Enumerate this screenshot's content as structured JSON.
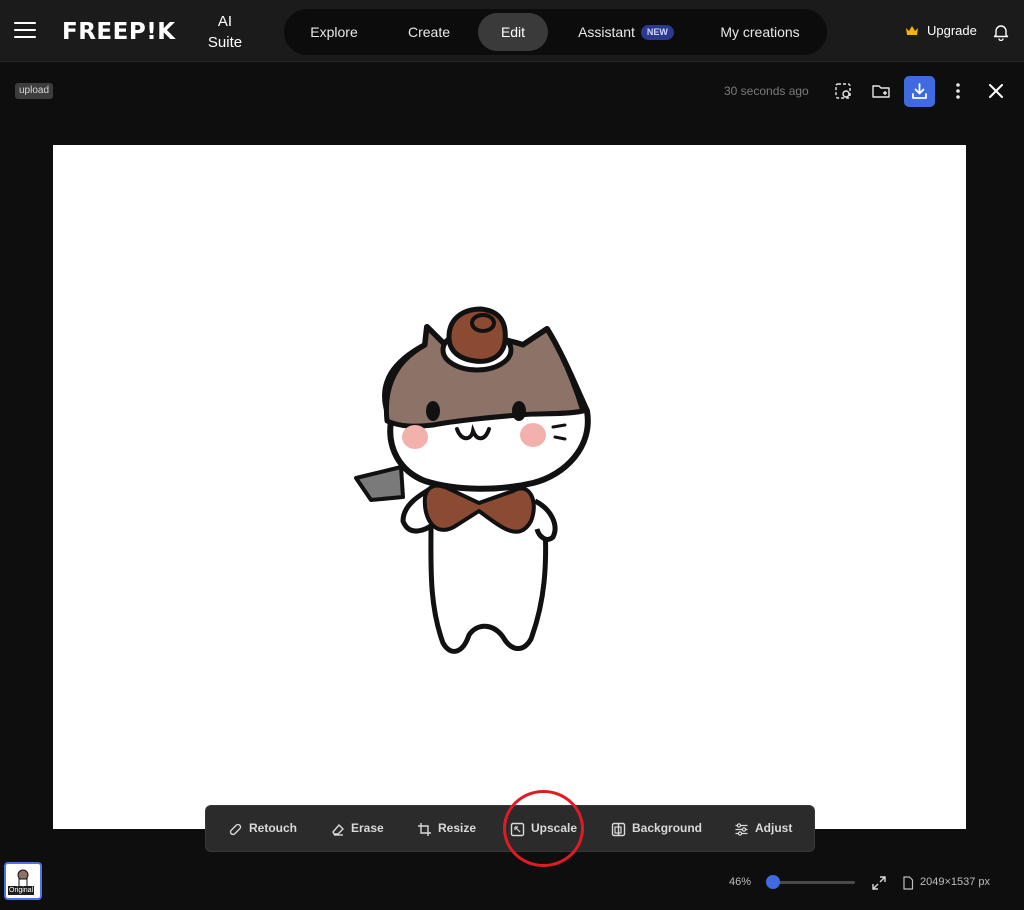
{
  "header": {
    "logo": "FREEP!K",
    "suite_line1": "AI",
    "suite_line2": "Suite",
    "nav": [
      {
        "label": "Explore"
      },
      {
        "label": "Create"
      },
      {
        "label": "Edit"
      },
      {
        "label": "Assistant",
        "badge": "NEW"
      },
      {
        "label": "My creations"
      }
    ],
    "active_nav": "Edit",
    "upgrade_label": "Upgrade"
  },
  "editor": {
    "tag": "upload",
    "timestamp": "30 seconds ago"
  },
  "toolbar": {
    "items": [
      {
        "label": "Retouch",
        "icon": "bandage-icon"
      },
      {
        "label": "Erase",
        "icon": "eraser-icon"
      },
      {
        "label": "Resize",
        "icon": "crop-icon"
      },
      {
        "label": "Upscale",
        "icon": "upscale-icon"
      },
      {
        "label": "Background",
        "icon": "background-icon"
      },
      {
        "label": "Adjust",
        "icon": "sliders-icon"
      }
    ]
  },
  "footer": {
    "thumbnail_label": "Original",
    "zoom": "46%",
    "zoom_value": 0.06,
    "dimensions": "2049×1537 px"
  },
  "colors": {
    "accent": "#3f6ae0",
    "annotation": "#e01c22",
    "crown": "#f5b400",
    "badge": "#2b3a8e"
  }
}
